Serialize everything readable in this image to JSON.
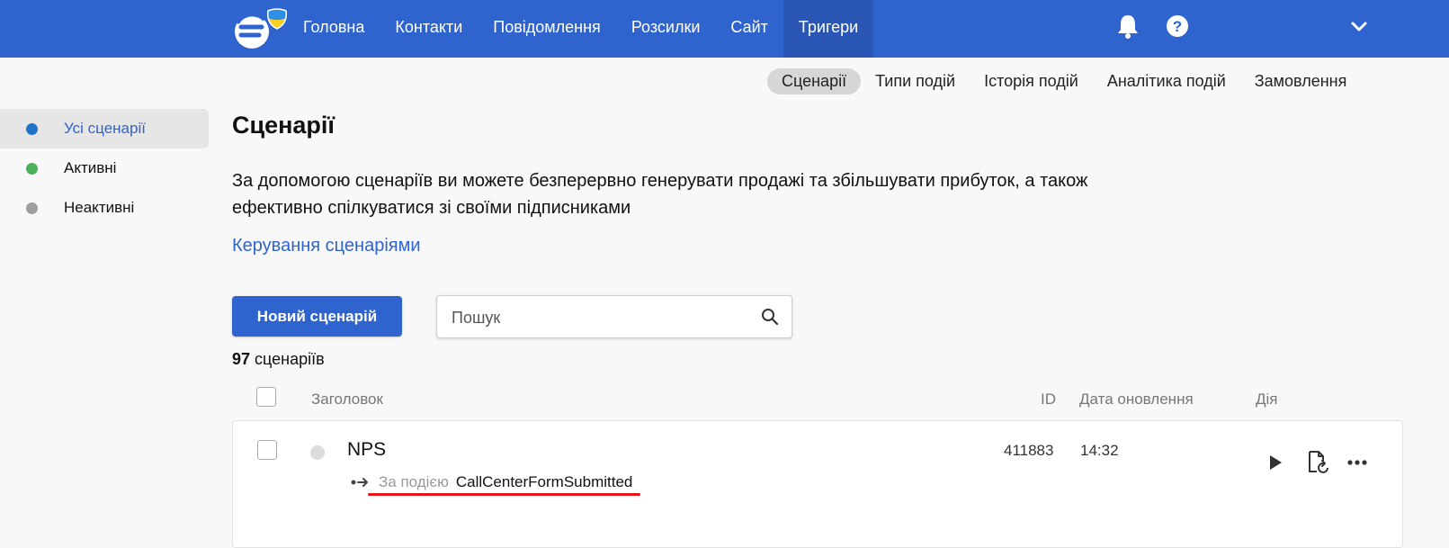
{
  "header": {
    "nav": [
      {
        "label": "Головна"
      },
      {
        "label": "Контакти"
      },
      {
        "label": "Повідомлення"
      },
      {
        "label": "Розсилки"
      },
      {
        "label": "Сайт"
      },
      {
        "label": "Тригери"
      }
    ],
    "active_nav": "Тригери",
    "icons": [
      "bell-icon",
      "help-icon",
      "chevron-down-icon"
    ],
    "brand_color": "#2f64cf"
  },
  "subnav": [
    {
      "label": "Сценарії"
    },
    {
      "label": "Типи подій"
    },
    {
      "label": "Історія подій"
    },
    {
      "label": "Аналітика подій"
    },
    {
      "label": "Замовлення"
    }
  ],
  "sidebar": {
    "items": [
      {
        "label": "Усі сценарії",
        "color": "#1f73c9"
      },
      {
        "label": "Активні",
        "color": "#4caf5a"
      },
      {
        "label": "Неактивні",
        "color": "#9e9e9e"
      }
    ]
  },
  "main": {
    "title": "Сценарії",
    "description": "За допомогою сценаріїв ви можете безперервно генерувати продажі та збільшувати прибуток, а також ефективно спілкуватися зі своїми підписниками",
    "manage_link": "Керування сценаріями",
    "new_button": "Новий сценарій",
    "search_placeholder": "Пошук",
    "count_value": "97",
    "count_label": "сценаріїв"
  },
  "table": {
    "headers": {
      "title": "Заголовок",
      "id": "ID",
      "date": "Дата оновлення",
      "action": "Дія"
    },
    "rows": [
      {
        "title": "NPS",
        "trigger_label": "За подією",
        "trigger_event": "CallCenterFormSubmitted",
        "id": "411883",
        "date": "14:32",
        "actions": [
          "play-icon",
          "file-refresh-icon",
          "more-icon"
        ]
      }
    ]
  }
}
